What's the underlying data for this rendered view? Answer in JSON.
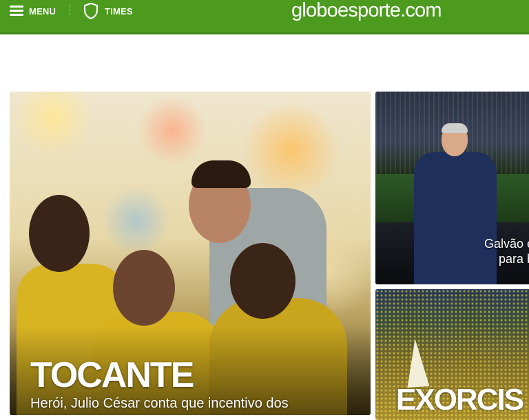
{
  "header": {
    "menu_label": "MENU",
    "times_label": "TIMES",
    "logo_text": "globoesporte.com",
    "bar_color": "#4c9a1e"
  },
  "cards": {
    "main": {
      "title": "TOCANTE",
      "subtitle": "Herói, Julio César conta que incentivo dos"
    },
    "second": {
      "caption_line1": "Galvão e",
      "caption_line2": "para b"
    },
    "third": {
      "title": "EXORCIS"
    }
  },
  "icons": [
    "menu-icon",
    "shield-icon"
  ]
}
